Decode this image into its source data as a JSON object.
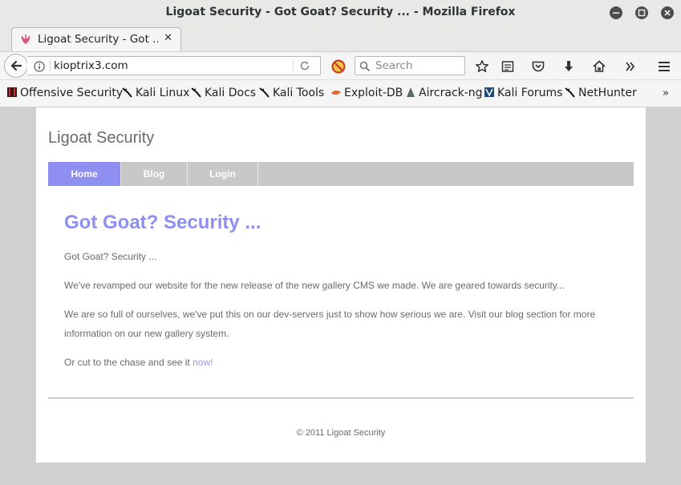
{
  "window": {
    "title": "Ligoat Security - Got Goat? Security ... - Mozilla Firefox"
  },
  "tab": {
    "title": "Ligoat Security - Got ...",
    "icon": "kali-dragon-favicon"
  },
  "navbar": {
    "url": "kioptrix3.com",
    "search_placeholder": "Search"
  },
  "bookmarks": [
    {
      "label": "Offensive Security",
      "icon": "offsec-icon"
    },
    {
      "label": "Kali Linux",
      "icon": "kali-icon"
    },
    {
      "label": "Kali Docs",
      "icon": "kali-icon"
    },
    {
      "label": "Kali Tools",
      "icon": "kali-icon"
    },
    {
      "label": "Exploit-DB",
      "icon": "exploit-db-icon"
    },
    {
      "label": "Aircrack-ng",
      "icon": "aircrack-icon"
    },
    {
      "label": "Kali Forums",
      "icon": "kali-forums-icon"
    },
    {
      "label": "NetHunter",
      "icon": "kali-icon"
    }
  ],
  "site": {
    "title": "Ligoat Security",
    "nav": {
      "home": "Home",
      "blog": "Blog",
      "login": "Login"
    },
    "heading": "Got Goat? Security ...",
    "paragraphs": [
      "Got Goat? Security ...",
      "We've revamped our website for the new release of the new gallery CMS we made. We are geared towards security...",
      "We are so full of ourselves, we've put this on our dev-servers just to show how serious we are. Visit our blog section for more information on our new gallery system."
    ],
    "cta_text": "Or cut to the chase and see it ",
    "cta_link": "now!",
    "footer": "© 2011 Ligoat Security"
  },
  "colors": {
    "accent": "#8f8ff2",
    "nav_bg": "#c8c8c8",
    "chrome_bg": "#f5f5f5",
    "desktop_bg": "#d0d0d0"
  }
}
